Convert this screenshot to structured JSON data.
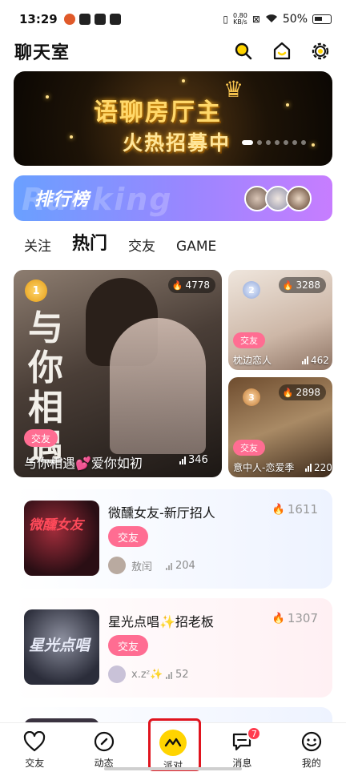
{
  "status_bar": {
    "time": "13:29",
    "net_speed": "0.80",
    "net_unit": "KB/s",
    "battery": "50%"
  },
  "header": {
    "title": "聊天室"
  },
  "banner": {
    "line1": "语聊房厅主",
    "line2": "火热招募中"
  },
  "ranking": {
    "label": "排行榜",
    "ghost": "Ranking"
  },
  "tabs": [
    {
      "label": "关注"
    },
    {
      "label": "热门"
    },
    {
      "label": "交友"
    },
    {
      "label": "GAME"
    }
  ],
  "feature_cards": [
    {
      "rank": "1",
      "heat": "4778",
      "poster_text": "与你相遇",
      "tag": "交友",
      "name": "与你相遇💕爱你如初",
      "online": "346"
    },
    {
      "rank": "2",
      "heat": "3288",
      "tag": "交友",
      "name": "枕边恋人",
      "online": "462"
    },
    {
      "rank": "3",
      "heat": "2898",
      "tag": "交友",
      "name": "意中人-恋爱季",
      "online": "220"
    }
  ],
  "rooms": [
    {
      "thumb_text": "微醺女友",
      "title": "微醺女友-新厅招人",
      "heat": "1611",
      "tag": "交友",
      "owner": "敖闰",
      "online": "204"
    },
    {
      "thumb_text": "星光点唱",
      "title": "星光点唱✨招老板",
      "heat": "1307",
      "tag": "交友",
      "owner": "x.zᶻ✨",
      "online": "52"
    }
  ],
  "bottom_nav": [
    {
      "label": "交友",
      "icon": "heart-icon"
    },
    {
      "label": "动态",
      "icon": "compass-icon"
    },
    {
      "label": "派对",
      "icon": "party-icon"
    },
    {
      "label": "消息",
      "icon": "message-icon",
      "badge": "7"
    },
    {
      "label": "我的",
      "icon": "smile-icon"
    }
  ],
  "colors": {
    "accent_yellow": "#ffd400",
    "tag_pink": "#ff6d92",
    "badge_red": "#ff3b4e"
  }
}
